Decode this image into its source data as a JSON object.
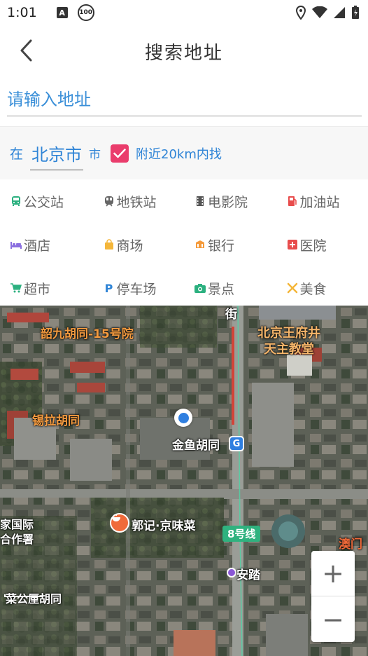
{
  "status_bar": {
    "time": "1:01",
    "notification_icon": "a-icon",
    "badge_text": "100"
  },
  "header": {
    "title": "搜索地址",
    "back_icon": "chevron-left-icon"
  },
  "search": {
    "placeholder": "请输入地址",
    "value": ""
  },
  "city_filter": {
    "prefix": "在",
    "city": "北京市",
    "suffix": "市",
    "nearby_checked": true,
    "nearby_label": "附近20km内找"
  },
  "categories": [
    {
      "label": "公交站",
      "icon": "bus-icon",
      "color": "#2bb07f"
    },
    {
      "label": "地铁站",
      "icon": "subway-icon",
      "color": "#666666"
    },
    {
      "label": "电影院",
      "icon": "film-icon",
      "color": "#555555"
    },
    {
      "label": "加油站",
      "icon": "gas-station-icon",
      "color": "#e84c4c"
    },
    {
      "label": "酒店",
      "icon": "bed-icon",
      "color": "#8a6fe0"
    },
    {
      "label": "商场",
      "icon": "shopping-bag-icon",
      "color": "#f4b63a"
    },
    {
      "label": "银行",
      "icon": "bank-icon",
      "color": "#f59a3a"
    },
    {
      "label": "医院",
      "icon": "hospital-icon",
      "color": "#e84c4c"
    },
    {
      "label": "超市",
      "icon": "cart-icon",
      "color": "#2bb07f"
    },
    {
      "label": "停车场",
      "icon": "parking-icon",
      "color": "#2f84d6"
    },
    {
      "label": "景点",
      "icon": "camera-icon",
      "color": "#2bb07f"
    },
    {
      "label": "美食",
      "icon": "fork-knife-icon",
      "color": "#f4b63a"
    }
  ],
  "map": {
    "labels": {
      "hutong15": "韶九胡同-15号院",
      "wangfujing_church_line1": "北京王府井",
      "wangfujing_church_line2": "天主教堂",
      "xila": "锡拉胡同",
      "jinyu": "金鱼胡同",
      "jiaguoji_line1": "家国际",
      "jiaguoji_line2": "合作署",
      "restaurant": "郭记·京味菜",
      "road_line": "8号线",
      "anlu": "安踏",
      "aomen": "澳门",
      "hutong_bottom": "菜公厘胡同",
      "street_top": "街"
    },
    "metro_letter": "G",
    "scale_label": "菜公厘",
    "zoom_in": "+",
    "zoom_out": "−"
  },
  "colors": {
    "accent_blue": "#2f84d6",
    "checkbox_pink": "#ea3d6c",
    "line_green": "#2fb27f"
  }
}
